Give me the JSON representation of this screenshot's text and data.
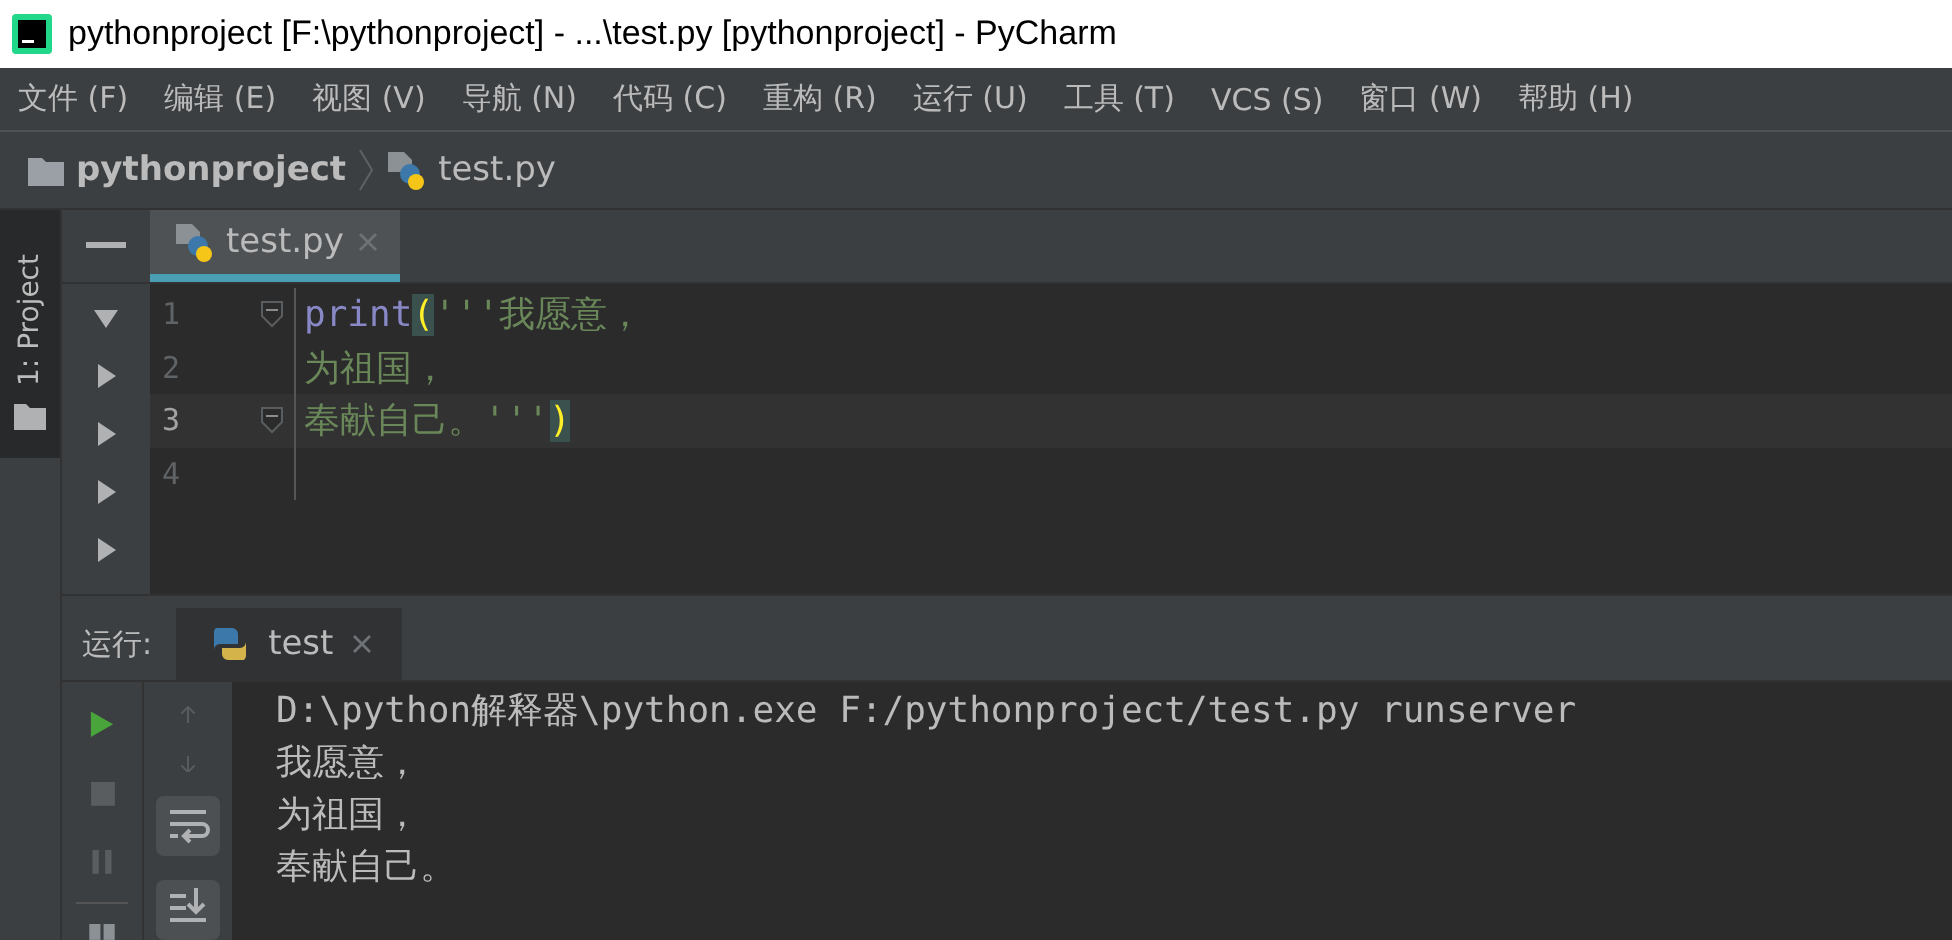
{
  "window": {
    "title": "pythonproject [F:\\pythonproject] - ...\\test.py [pythonproject] - PyCharm"
  },
  "menu": [
    "文件 (F)",
    "编辑 (E)",
    "视图 (V)",
    "导航 (N)",
    "代码 (C)",
    "重构 (R)",
    "运行 (U)",
    "工具 (T)",
    "VCS (S)",
    "窗口 (W)",
    "帮助 (H)"
  ],
  "breadcrumb": [
    "pythonproject",
    "test.py"
  ],
  "side_tab": {
    "label": "1: Project",
    "selected": true
  },
  "tree": [
    {
      "expanded": true
    },
    {
      "expanded": false
    },
    {
      "expanded": false
    },
    {
      "expanded": false
    },
    {
      "expanded": false
    }
  ],
  "editor": {
    "tabs": [
      {
        "label": "test.py",
        "selected": true
      }
    ],
    "lines": [
      {
        "number": "1",
        "current": false,
        "fold": true,
        "tokens": [
          {
            "kind": "builtin",
            "text": "print"
          },
          {
            "kind": "brace",
            "text": "("
          },
          {
            "kind": "string",
            "text": "'''我愿意，"
          }
        ]
      },
      {
        "number": "2",
        "current": false,
        "fold": false,
        "tokens": [
          {
            "kind": "string",
            "text": "为祖国，"
          }
        ]
      },
      {
        "number": "3",
        "current": true,
        "fold": true,
        "tokens": [
          {
            "kind": "string",
            "text": "奉献自己。'''"
          },
          {
            "kind": "brace",
            "text": ")"
          }
        ]
      },
      {
        "number": "4",
        "current": false,
        "fold": false
      }
    ]
  },
  "run": {
    "label": "运行:",
    "tabs": [
      {
        "label": "test",
        "selected": true
      }
    ],
    "console": [
      "D:\\python解释器\\python.exe F:/pythonproject/test.py runserver",
      "我愿意，",
      "为祖国，",
      "奉献自己。"
    ]
  }
}
